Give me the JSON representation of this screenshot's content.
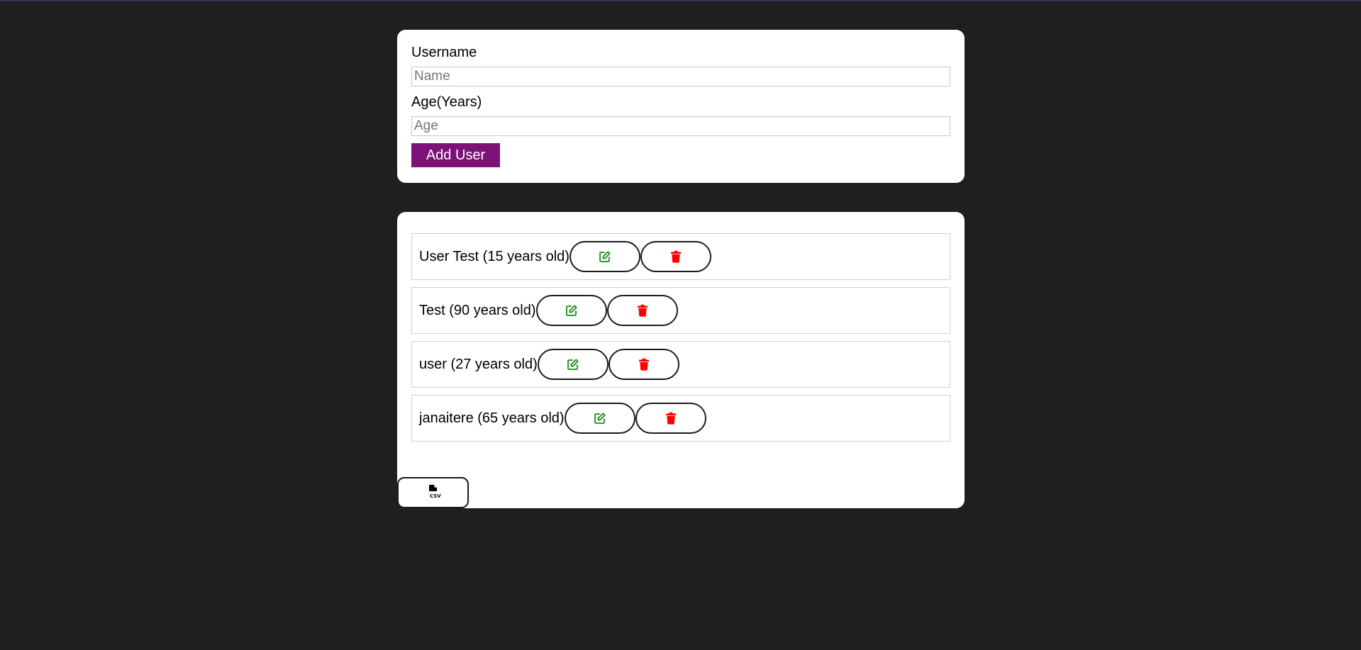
{
  "theme": {
    "accent": "#7b1378",
    "edit_icon_color": "#1a8a1a",
    "delete_icon_color": "#ff0000"
  },
  "form": {
    "username_label": "Username",
    "username_placeholder": "Name",
    "username_value": "",
    "age_label": "Age(Years)",
    "age_placeholder": "Age",
    "age_value": "",
    "add_button_label": "Add User"
  },
  "users": [
    {
      "text": "User Test (15 years old)",
      "edit_icon": "edit-icon",
      "delete_icon": "trash-icon"
    },
    {
      "text": "Test (90 years old)",
      "edit_icon": "edit-icon",
      "delete_icon": "trash-icon"
    },
    {
      "text": "user (27 years old)",
      "edit_icon": "edit-icon",
      "delete_icon": "trash-icon"
    },
    {
      "text": "janaitere (65 years old)",
      "edit_icon": "edit-icon",
      "delete_icon": "trash-icon"
    }
  ],
  "export": {
    "icon": "csv-file-icon",
    "icon_text": "CSV"
  }
}
